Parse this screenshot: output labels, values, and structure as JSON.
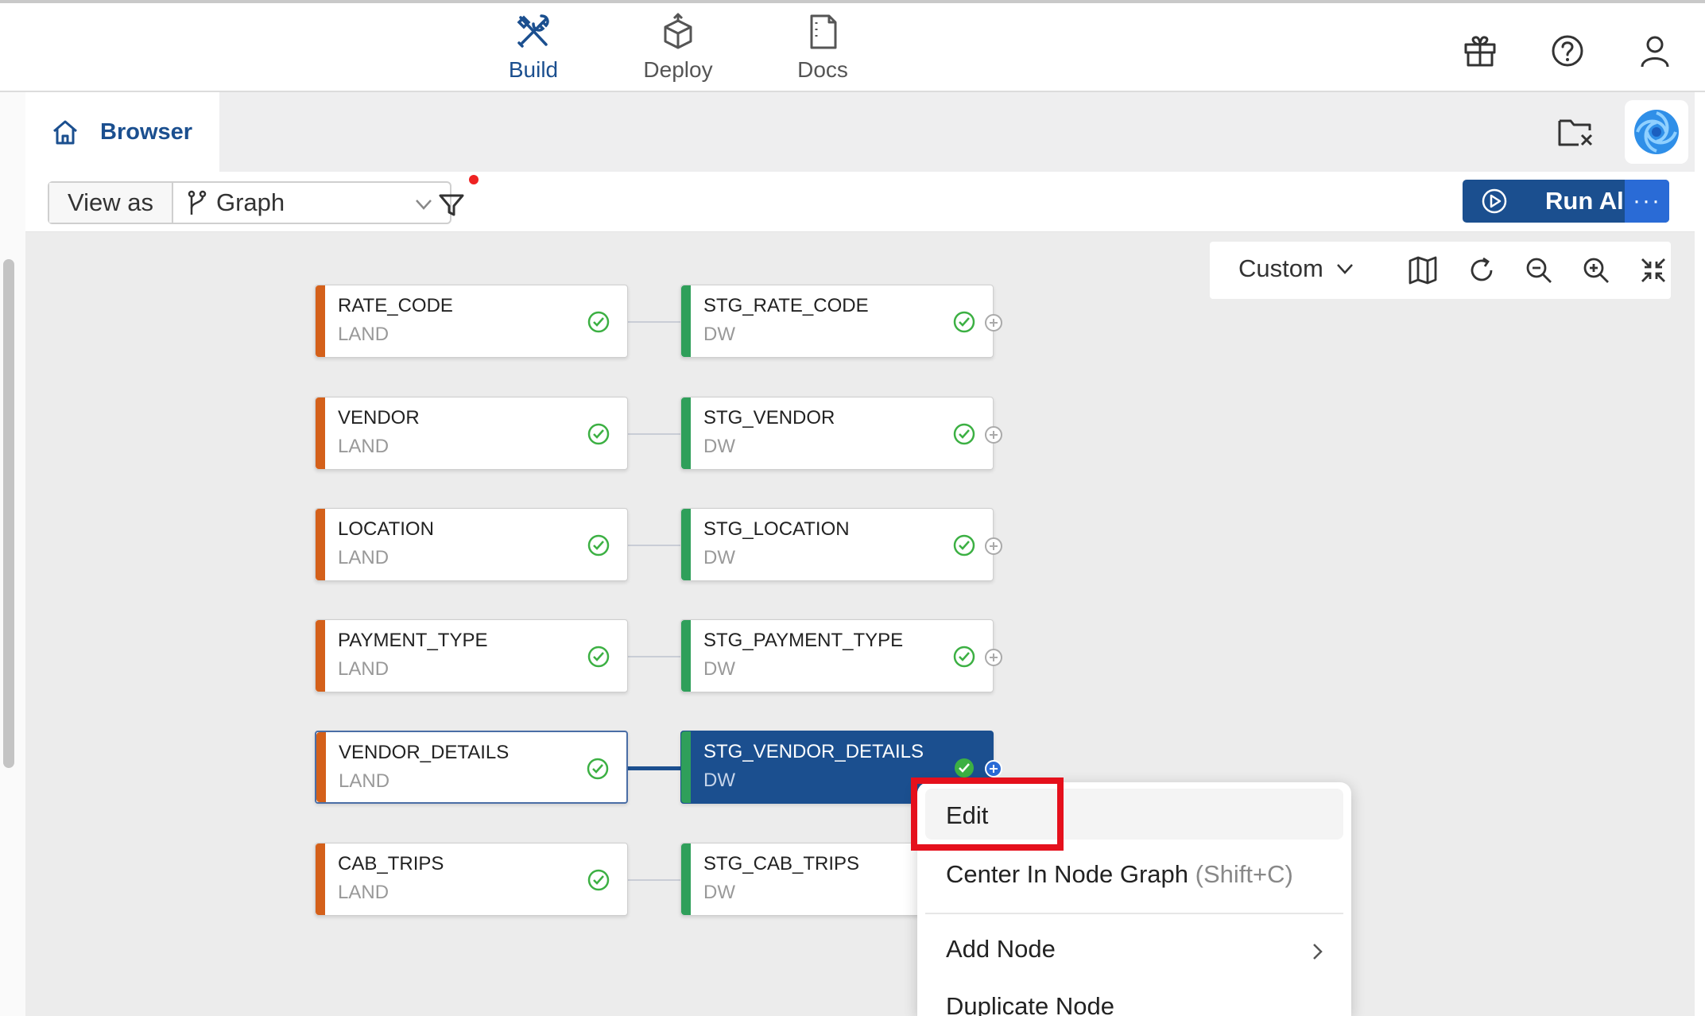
{
  "topnav": {
    "tabs": [
      {
        "label": "Build",
        "icon": "build-tools-icon",
        "active": true
      },
      {
        "label": "Deploy",
        "icon": "deploy-box-icon",
        "active": false
      },
      {
        "label": "Docs",
        "icon": "docs-icon",
        "active": false
      }
    ],
    "right_icons": [
      "gift-icon",
      "help-icon",
      "user-icon"
    ]
  },
  "subheader": {
    "browser_label": "Browser"
  },
  "toolbar": {
    "view_as_label": "View as",
    "view_as_value": "Graph",
    "run_all_label": "Run All",
    "more_label": "···"
  },
  "graph_controls": {
    "layout_label": "Custom"
  },
  "nodes": [
    {
      "source": {
        "name": "RATE_CODE",
        "type": "LAND"
      },
      "target": {
        "name": "STG_RATE_CODE",
        "type": "DW"
      }
    },
    {
      "source": {
        "name": "VENDOR",
        "type": "LAND"
      },
      "target": {
        "name": "STG_VENDOR",
        "type": "DW"
      }
    },
    {
      "source": {
        "name": "LOCATION",
        "type": "LAND"
      },
      "target": {
        "name": "STG_LOCATION",
        "type": "DW"
      }
    },
    {
      "source": {
        "name": "PAYMENT_TYPE",
        "type": "LAND"
      },
      "target": {
        "name": "STG_PAYMENT_TYPE",
        "type": "DW"
      }
    },
    {
      "source": {
        "name": "VENDOR_DETAILS",
        "type": "LAND"
      },
      "target": {
        "name": "STG_VENDOR_DETAILS",
        "type": "DW"
      }
    },
    {
      "source": {
        "name": "CAB_TRIPS",
        "type": "LAND"
      },
      "target": {
        "name": "STG_CAB_TRIPS",
        "type": "DW"
      }
    }
  ],
  "context_menu": {
    "edit": "Edit",
    "center": "Center In Node Graph",
    "center_hint": "(Shift+C)",
    "add_node": "Add Node",
    "duplicate_node": "Duplicate Node"
  },
  "colors": {
    "brand_blue": "#1b4f8f",
    "land_accent": "#d4601a",
    "dw_accent": "#2f9f5a",
    "status_ok": "#3cb043",
    "highlight_red": "#e5101c"
  }
}
